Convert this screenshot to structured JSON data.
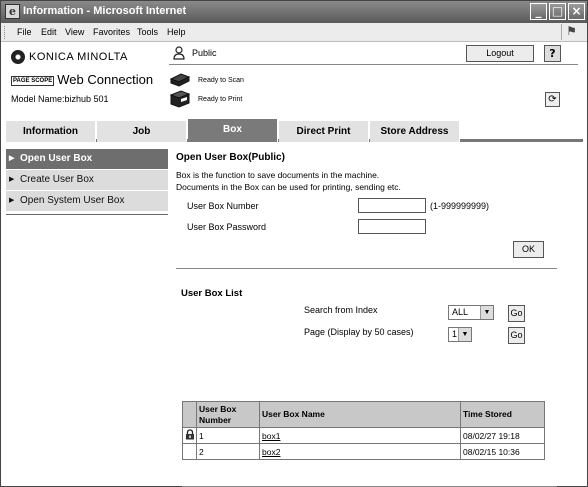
{
  "window": {
    "title": "Information - Microsoft Internet",
    "menu": [
      "File",
      "Edit",
      "View",
      "Favorites",
      "Tools",
      "Help"
    ]
  },
  "header": {
    "brand": "KONICA MINOLTA",
    "product": "Web Connection",
    "product_prefix": "PAGE SCOPE",
    "model": "Model Name:bizhub 501",
    "user": "Public",
    "logout_label": "Logout",
    "help_label": "?",
    "scan_status": "Ready to Scan",
    "print_status": "Ready to Print"
  },
  "tabs": [
    {
      "label": "Information",
      "active": false
    },
    {
      "label": "Job",
      "active": false
    },
    {
      "label": "Box",
      "active": true
    },
    {
      "label": "Direct Print",
      "active": false
    },
    {
      "label": "Store Address",
      "active": false
    }
  ],
  "sidebar": {
    "items": [
      {
        "label": "Open User Box",
        "active": true
      },
      {
        "label": "Create User Box",
        "active": false
      },
      {
        "label": "Open System User Box",
        "active": false
      }
    ]
  },
  "main": {
    "title": "Open User Box(Public)",
    "desc_line1": "Box is the function to save documents in the machine.",
    "desc_line2": "Documents in the Box can be used for printing, sending etc.",
    "box_number_label": "User Box Number",
    "box_number_value": "",
    "box_number_hint": "(1-999999999)",
    "box_password_label": "User Box Password",
    "box_password_value": "",
    "ok_label": "OK",
    "list_title": "User Box List",
    "search_label": "Search from Index",
    "search_value": "ALL",
    "page_label": "Page (Display by 50 cases)",
    "page_value": "1",
    "go_label": "Go",
    "columns": [
      "User Box Number",
      "User Box Name",
      "Time Stored"
    ],
    "rows": [
      {
        "number": "1",
        "name": "box1",
        "time": "08/02/27 19:18",
        "locked": true
      },
      {
        "number": "2",
        "name": "box2",
        "time": "08/02/15 10:36",
        "locked": false
      }
    ]
  }
}
